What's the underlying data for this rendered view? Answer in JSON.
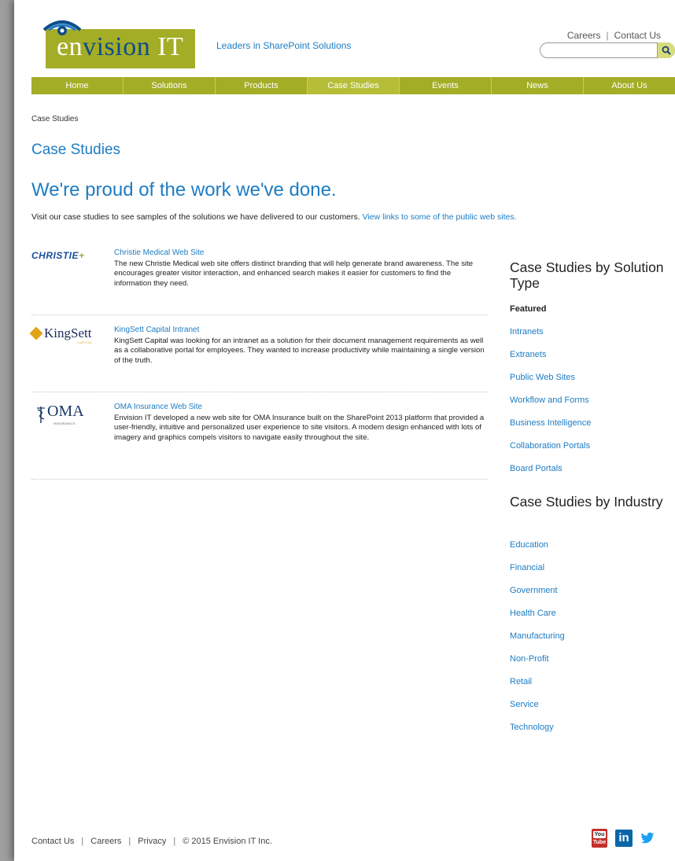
{
  "header": {
    "logo": {
      "text_en": "en",
      "text_vision": "vision",
      "text_it": " IT"
    },
    "tagline": "Leaders in SharePoint Solutions",
    "util_links": [
      {
        "label": "Careers"
      },
      {
        "label": "Contact Us"
      }
    ],
    "search": {
      "value": "",
      "placeholder": ""
    }
  },
  "nav": {
    "items": [
      {
        "label": "Home"
      },
      {
        "label": "Solutions"
      },
      {
        "label": "Products"
      },
      {
        "label": "Case Studies",
        "active": true
      },
      {
        "label": "Events"
      },
      {
        "label": "News"
      },
      {
        "label": "About Us"
      }
    ]
  },
  "breadcrumb": "Case Studies",
  "page_title": "Case Studies",
  "headline": "We're proud of the work we've done.",
  "intro": {
    "text": "Visit our case studies to see samples of the solutions we have delivered to our customers.",
    "link": "View links to some of the public web sites."
  },
  "cases": [
    {
      "logo_text": "CHRISTIE",
      "logo_plus": "+",
      "title": "Christie Medical Web Site",
      "desc": "The new Christie Medical web site offers distinct branding that will help generate brand awareness. The site encourages greater visitor interaction, and enhanced search makes it easier for customers to find the information they need."
    },
    {
      "logo_text": "KingSett",
      "logo_sub": "CAPITAL",
      "title": "KingSett Capital Intranet",
      "desc": "KingSett Capital was looking for an intranet as a solution for their document management requirements as well as a collaborative portal for employees.  They wanted to increase productivity while maintaining a single version of the truth."
    },
    {
      "logo_text": "OMA",
      "logo_sub": "INSURANCE",
      "title": "OMA Insurance Web Site",
      "desc": "Envision IT developed a new web site for OMA Insurance built on the SharePoint 2013 platform that provided a user-friendly, intuitive and personalized user experience to site visitors. A modern design enhanced with lots of imagery and graphics compels visitors to navigate easily throughout the site."
    }
  ],
  "sidebar": {
    "solution_heading": "Case Studies by Solution Type",
    "solution_links": [
      {
        "label": "Featured",
        "selected": true
      },
      {
        "label": "Intranets"
      },
      {
        "label": "Extranets"
      },
      {
        "label": "Public Web Sites"
      },
      {
        "label": "Workflow and Forms"
      },
      {
        "label": "Business Intelligence"
      },
      {
        "label": "Collaboration Portals"
      },
      {
        "label": "Board Portals"
      }
    ],
    "industry_heading": "Case Studies by Industry",
    "industry_links": [
      {
        "label": "Education"
      },
      {
        "label": "Financial"
      },
      {
        "label": "Government"
      },
      {
        "label": "Health Care"
      },
      {
        "label": "Manufacturing"
      },
      {
        "label": "Non-Profit"
      },
      {
        "label": "Retail"
      },
      {
        "label": "Service"
      },
      {
        "label": "Technology"
      }
    ]
  },
  "footer": {
    "links": [
      {
        "label": "Contact Us"
      },
      {
        "label": "Careers"
      },
      {
        "label": "Privacy"
      }
    ],
    "copyright": "© 2015 Envision IT Inc.",
    "social": [
      {
        "icon": "youtube-icon",
        "top": "You",
        "bottom": "Tube"
      },
      {
        "icon": "linkedin-icon",
        "label": "in"
      },
      {
        "icon": "twitter-icon"
      }
    ]
  },
  "colors": {
    "brand_green": "#a4ad26",
    "link_blue": "#1d7cc3",
    "logo_navy": "#0f4d8a"
  }
}
